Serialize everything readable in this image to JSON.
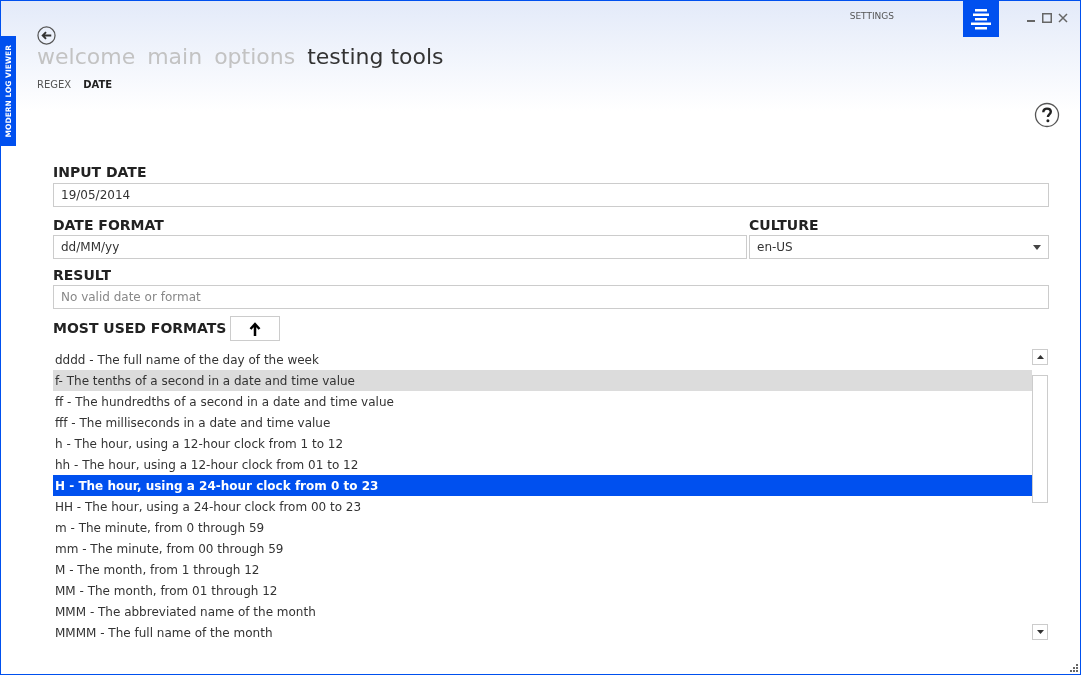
{
  "app_tab": {
    "label": "MODERN LOG VIEWER"
  },
  "title_bar": {
    "settings": "SETTINGS"
  },
  "nav": [
    {
      "label": "welcome",
      "selected": false
    },
    {
      "label": "main",
      "selected": false
    },
    {
      "label": "options",
      "selected": false
    },
    {
      "label": "testing tools",
      "selected": true
    }
  ],
  "subnav": [
    {
      "label": "REGEX",
      "selected": false
    },
    {
      "label": "DATE",
      "selected": true
    }
  ],
  "input_date": {
    "label": "INPUT DATE",
    "value": "19/05/2014"
  },
  "date_format": {
    "label": "DATE FORMAT",
    "value": "dd/MM/yy"
  },
  "culture": {
    "label": "CULTURE",
    "value": "en-US"
  },
  "result": {
    "label": "RESULT",
    "placeholder": "No valid date or format"
  },
  "formats": {
    "label": "MOST USED FORMATS",
    "items": [
      {
        "text": "dddd - The full name of the day of the week",
        "selected": false,
        "hovered": false
      },
      {
        "text": "f- The tenths of a second in a date and time value",
        "selected": false,
        "hovered": true
      },
      {
        "text": "ff - The hundredths of a second in a date and time value",
        "selected": false,
        "hovered": false
      },
      {
        "text": "fff - The milliseconds in a date and time value",
        "selected": false,
        "hovered": false
      },
      {
        "text": "h - The hour, using a 12-hour clock from 1 to 12",
        "selected": false,
        "hovered": false
      },
      {
        "text": "hh - The hour, using a 12-hour clock from 01 to 12",
        "selected": false,
        "hovered": false
      },
      {
        "text": "H - The hour, using a 24-hour clock from 0 to 23",
        "selected": true,
        "hovered": false
      },
      {
        "text": "HH - The hour, using a 24-hour clock from 00 to 23",
        "selected": false,
        "hovered": false
      },
      {
        "text": "m - The minute, from 0 through 59",
        "selected": false,
        "hovered": false
      },
      {
        "text": "mm - The minute, from 00 through 59",
        "selected": false,
        "hovered": false
      },
      {
        "text": "M - The month, from 1 through 12",
        "selected": false,
        "hovered": false
      },
      {
        "text": "MM - The month, from 01 through 12",
        "selected": false,
        "hovered": false
      },
      {
        "text": "MMM - The abbreviated name of the month",
        "selected": false,
        "hovered": false
      },
      {
        "text": "MMMM - The full name of the month",
        "selected": false,
        "hovered": false
      }
    ]
  }
}
